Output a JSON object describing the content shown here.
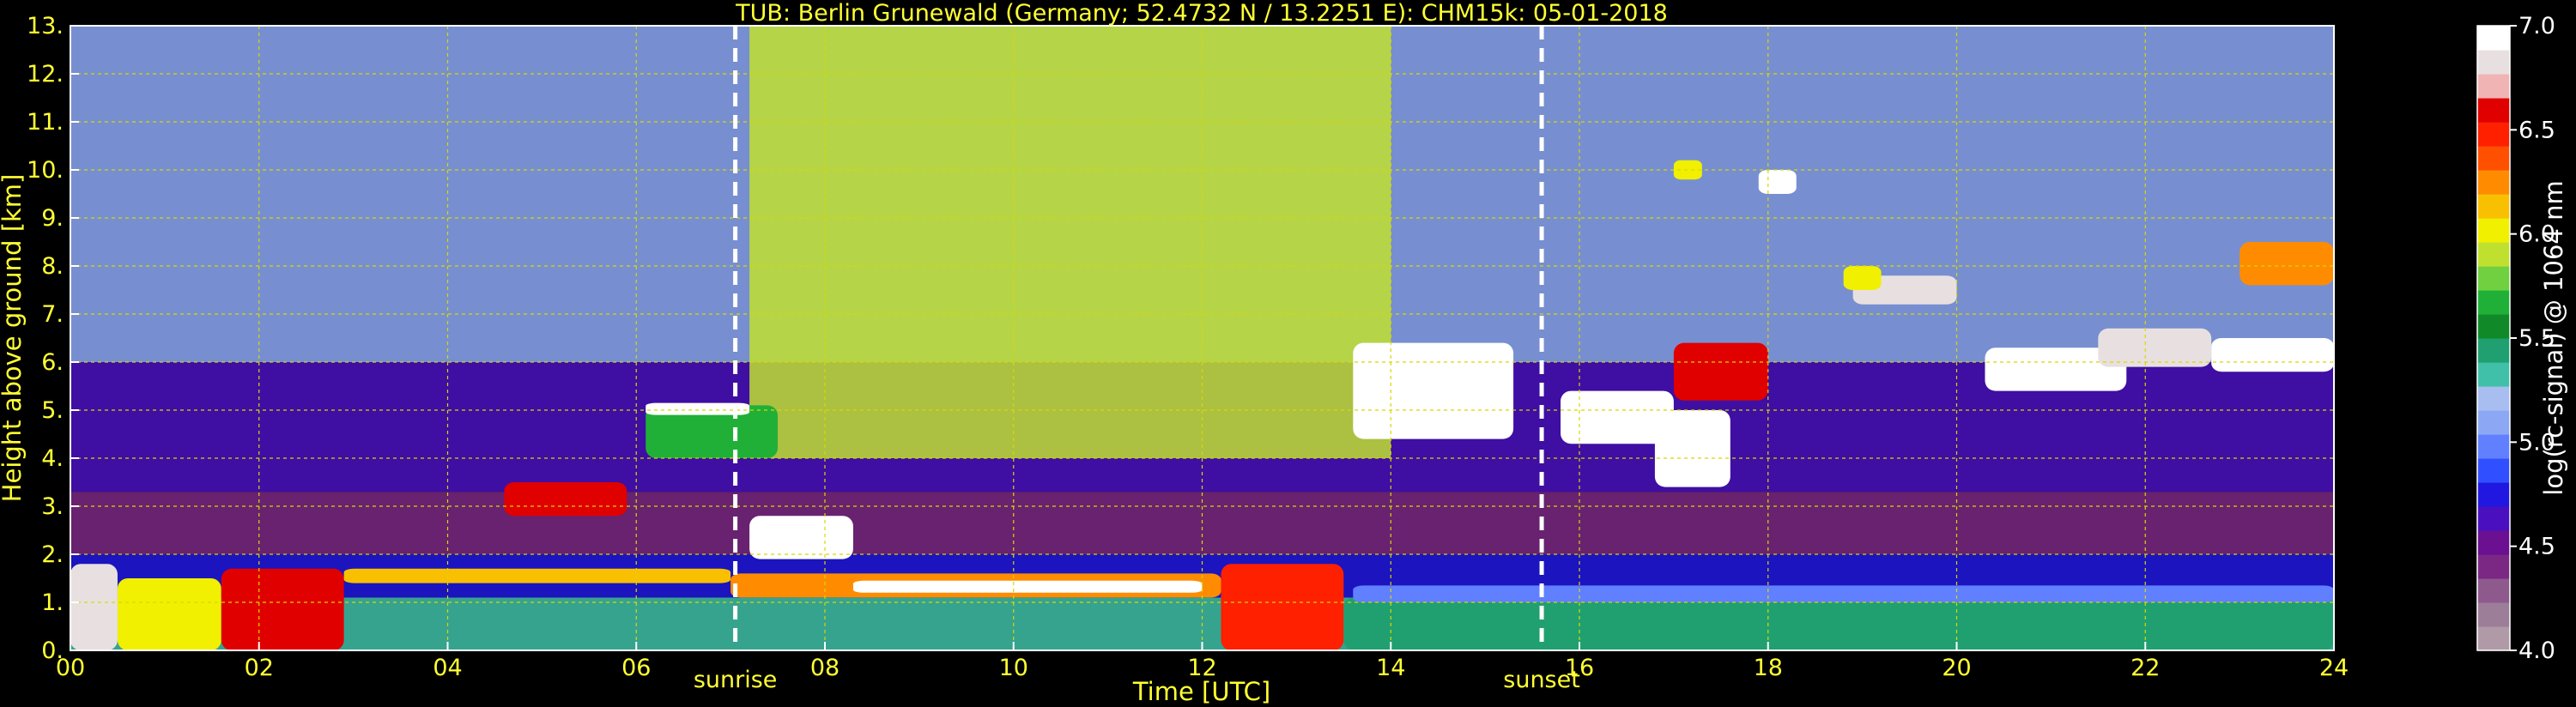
{
  "chart_data": {
    "type": "heatmap",
    "title": "TUB: Berlin Grunewald (Germany; 52.4732 N / 13.2251 E):    CHM15k: 05-01-2018",
    "xlabel": "Time [UTC]",
    "ylabel": "Height above ground [km]",
    "xlim": [
      0,
      24
    ],
    "ylim": [
      0,
      13
    ],
    "x_ticks": [
      "00",
      "02",
      "04",
      "06",
      "08",
      "10",
      "12",
      "14",
      "16",
      "18",
      "20",
      "22",
      "24"
    ],
    "x_tick_values": [
      0,
      2,
      4,
      6,
      8,
      10,
      12,
      14,
      16,
      18,
      20,
      22,
      24
    ],
    "y_ticks": [
      "0.",
      "1.",
      "2.",
      "3.",
      "4.",
      "5.",
      "6.",
      "7.",
      "8.",
      "9.",
      "10.",
      "11.",
      "12.",
      "13."
    ],
    "grid": true,
    "markers": [
      {
        "label": "sunrise",
        "x": 7.05
      },
      {
        "label": "sunset",
        "x": 15.6
      }
    ],
    "colorbar": {
      "label": "log(rc-signal) @ 1064 nm",
      "range": [
        4.0,
        7.0
      ],
      "ticks": [
        "4.0",
        "4.5",
        "5.0",
        "5.5",
        "6.0",
        "6.5",
        "7.0"
      ],
      "tick_values": [
        4.0,
        4.5,
        5.0,
        5.5,
        6.0,
        6.5,
        7.0
      ],
      "colors": [
        "#b09aa8",
        "#9c7e98",
        "#8e5a8e",
        "#7a2884",
        "#6a1090",
        "#4a10c0",
        "#2018e0",
        "#3050ff",
        "#6080ff",
        "#8ca8f4",
        "#a8bef0",
        "#40c0a8",
        "#20a070",
        "#108a28",
        "#20b038",
        "#70d040",
        "#c0e030",
        "#f0f000",
        "#f8c000",
        "#ff8c00",
        "#ff5000",
        "#ff2000",
        "#e00000",
        "#f0b4b4",
        "#e8e0e0",
        "#ffffff"
      ]
    },
    "layers": [
      {
        "from": 0,
        "to": 24,
        "y0": 0.0,
        "y1": 1.1,
        "level": 5.3
      },
      {
        "from": 0,
        "to": 24,
        "y0": 1.1,
        "y1": 2.0,
        "level": 4.8
      },
      {
        "from": 0,
        "to": 24,
        "y0": 2.0,
        "y1": 3.3,
        "level": 4.4
      },
      {
        "from": 0,
        "to": 24,
        "y0": 3.3,
        "y1": 6.0,
        "level": 4.6
      },
      {
        "from": 0,
        "to": 24,
        "y0": 6.0,
        "y1": 13.0,
        "level": 5.1
      },
      {
        "from": 7.2,
        "to": 14.0,
        "y0": 4.0,
        "y1": 13.0,
        "level": 5.9
      }
    ],
    "clouds": [
      {
        "x0": 0.0,
        "x1": 0.5,
        "y0": 0.0,
        "y1": 1.8,
        "level": 6.8
      },
      {
        "x0": 0.5,
        "x1": 1.6,
        "y0": 0.0,
        "y1": 1.5,
        "level": 6.0
      },
      {
        "x0": 1.6,
        "x1": 2.9,
        "y0": 0.0,
        "y1": 1.7,
        "level": 6.6
      },
      {
        "x0": 2.9,
        "x1": 7.0,
        "y0": 1.4,
        "y1": 1.7,
        "level": 6.1
      },
      {
        "x0": 7.0,
        "x1": 12.2,
        "y0": 1.1,
        "y1": 1.6,
        "level": 6.2
      },
      {
        "x0": 8.3,
        "x1": 12.0,
        "y0": 1.2,
        "y1": 1.45,
        "level": 7.0
      },
      {
        "x0": 12.2,
        "x1": 13.5,
        "y0": 0.0,
        "y1": 1.8,
        "level": 6.5
      },
      {
        "x0": 13.5,
        "x1": 24.0,
        "y0": 0.0,
        "y1": 1.1,
        "level": 5.4
      },
      {
        "x0": 13.6,
        "x1": 24.0,
        "y0": 1.0,
        "y1": 1.35,
        "level": 5.0
      },
      {
        "x0": 4.6,
        "x1": 5.9,
        "y0": 2.8,
        "y1": 3.5,
        "level": 6.6
      },
      {
        "x0": 6.1,
        "x1": 7.5,
        "y0": 4.0,
        "y1": 5.1,
        "level": 5.7
      },
      {
        "x0": 6.1,
        "x1": 7.2,
        "y0": 4.9,
        "y1": 5.15,
        "level": 7.0
      },
      {
        "x0": 7.2,
        "x1": 8.3,
        "y0": 1.9,
        "y1": 2.8,
        "level": 7.0
      },
      {
        "x0": 13.6,
        "x1": 15.3,
        "y0": 4.4,
        "y1": 6.4,
        "level": 6.9
      },
      {
        "x0": 15.8,
        "x1": 17.0,
        "y0": 4.3,
        "y1": 5.4,
        "level": 6.9
      },
      {
        "x0": 16.8,
        "x1": 17.6,
        "y0": 3.4,
        "y1": 5.0,
        "level": 6.9
      },
      {
        "x0": 17.0,
        "x1": 18.0,
        "y0": 5.2,
        "y1": 6.4,
        "level": 6.6
      },
      {
        "x0": 17.9,
        "x1": 18.3,
        "y0": 9.5,
        "y1": 10.0,
        "level": 7.0
      },
      {
        "x0": 17.0,
        "x1": 17.3,
        "y0": 9.8,
        "y1": 10.2,
        "level": 6.0
      },
      {
        "x0": 18.9,
        "x1": 20.0,
        "y0": 7.2,
        "y1": 7.8,
        "level": 6.8
      },
      {
        "x0": 18.8,
        "x1": 19.2,
        "y0": 7.5,
        "y1": 8.0,
        "level": 6.0
      },
      {
        "x0": 20.3,
        "x1": 21.8,
        "y0": 5.4,
        "y1": 6.3,
        "level": 7.0
      },
      {
        "x0": 21.5,
        "x1": 22.7,
        "y0": 5.9,
        "y1": 6.7,
        "level": 6.8
      },
      {
        "x0": 22.7,
        "x1": 24.0,
        "y0": 5.8,
        "y1": 6.5,
        "level": 7.0
      },
      {
        "x0": 23.0,
        "x1": 24.0,
        "y0": 7.6,
        "y1": 8.5,
        "level": 6.2
      }
    ]
  }
}
